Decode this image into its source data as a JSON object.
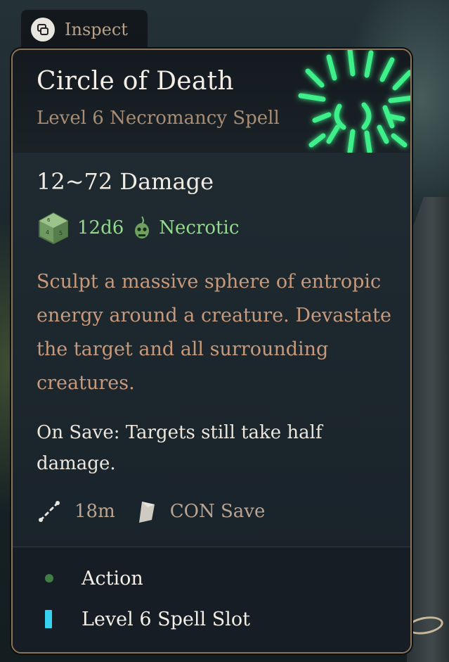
{
  "inspect": {
    "label": "Inspect"
  },
  "tooltip": {
    "title": "Circle of Death",
    "subtitle": "Level 6 Necromancy Spell",
    "damage_title": "12~72 Damage",
    "dice": "12d6",
    "damage_type": "Necrotic",
    "description": "Sculpt a massive sphere of entropic energy around a creature. Devastate the target and all surrounding creatures.",
    "on_save": "On Save: Targets still take half damage.",
    "range": "18m",
    "save": "CON Save",
    "costs": [
      {
        "label": "Action",
        "icon": "action-dot-icon",
        "color": "#3f7d43"
      },
      {
        "label": "Level 6 Spell Slot",
        "icon": "spell-slot-icon",
        "color": "#35d3f0"
      }
    ]
  },
  "colors": {
    "title": "#f3eee6",
    "subtitle": "#a88d74",
    "damage_green": "#93db8a",
    "description": "#c89a7b",
    "border": "#8b7457"
  }
}
